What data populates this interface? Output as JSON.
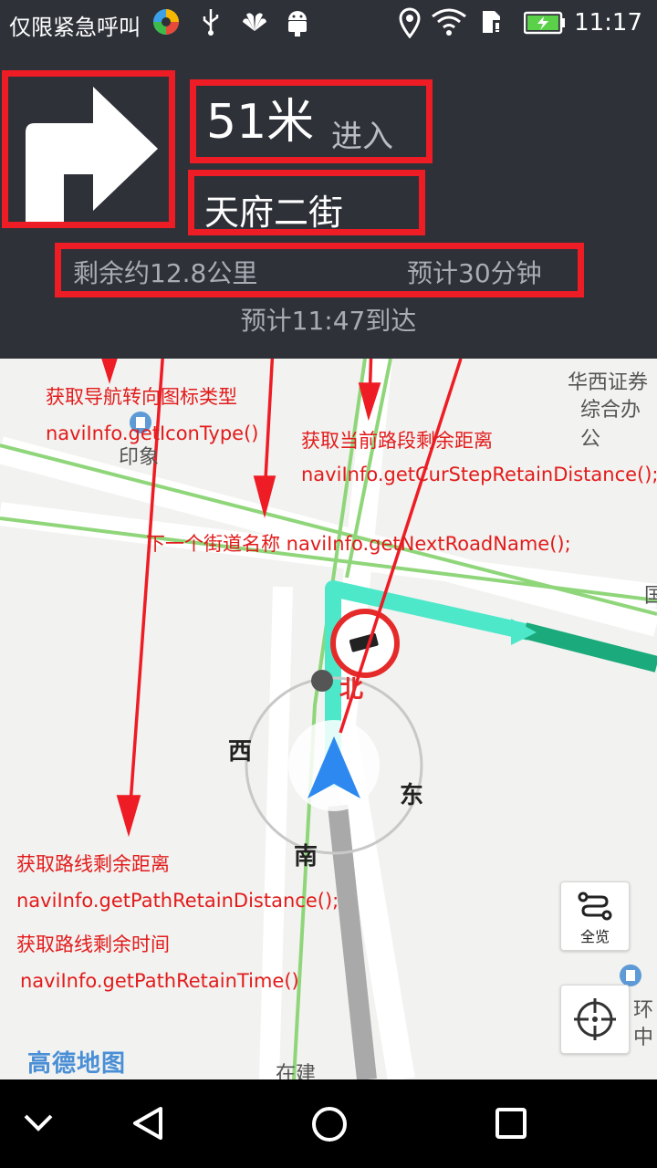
{
  "status_bar": {
    "carrier_text": "仅限紧急呼叫",
    "time": "11:17",
    "icons": [
      "app-icon",
      "usb-icon",
      "huawei-icon",
      "android-icon",
      "location-icon",
      "wifi-icon",
      "sim-icon",
      "battery-charging-icon"
    ]
  },
  "navigation": {
    "turn_icon": "turn-right-arrow-icon",
    "distance": "51米",
    "action": "进入",
    "next_road": "天府二街",
    "remaining_distance": "剩余约12.8公里",
    "remaining_time": "预计30分钟",
    "arrival": "预计11:47到达"
  },
  "annotations": {
    "icon_type_title": "获取导航转向图标类型",
    "icon_type_code": "naviInfo.getIconType()",
    "cur_step_title": "获取当前路段剩余距离",
    "cur_step_code": "naviInfo.getCurStepRetainDistance();",
    "next_road_note": "下一个街道名称 naviInfo.getNextRoadName();",
    "path_distance_title": "获取路线剩余距离",
    "path_distance_code": "naviInfo.getPathRetainDistance();",
    "path_time_title": "获取路线剩余时间",
    "path_time_code": "naviInfo.getPathRetainTime()"
  },
  "map": {
    "labels": {
      "poi_top_right_1": "华西证券",
      "poi_top_right_2": "综合办公",
      "poi_left": "印象",
      "right_edge": "国",
      "bottom_right_1": "环",
      "bottom_right_2": "中",
      "bottom_street": "在建"
    },
    "compass": {
      "north": "北",
      "south": "南",
      "east": "东",
      "west": "西"
    },
    "overview_label": "全览",
    "logo_text": "高德地图"
  },
  "nav_bar": {
    "icons": [
      "chevron-down-icon",
      "back-triangle-icon",
      "home-circle-icon",
      "recent-square-icon"
    ]
  },
  "colors": {
    "annotation_red": "#ee1c24",
    "panel_bg": "#2e3138",
    "route_cyan": "#4de8c9",
    "route_green": "#1aaa7c"
  }
}
